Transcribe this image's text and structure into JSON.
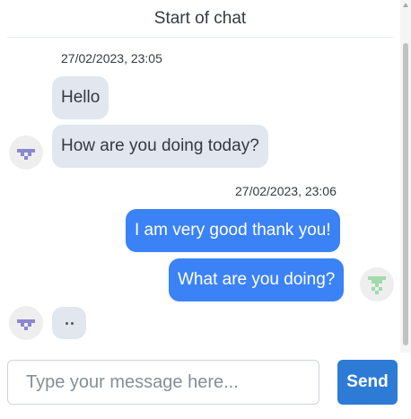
{
  "header": {
    "title": "Start of chat"
  },
  "messages": {
    "group1": {
      "timestamp": "27/02/2023, 23:05",
      "bubbles": [
        "Hello",
        "How are you doing today?"
      ]
    },
    "group2": {
      "timestamp": "27/02/2023, 23:06",
      "bubbles": [
        "I am very good thank you!",
        "What are you doing?"
      ]
    }
  },
  "typing": {
    "indicator": "typing-dots"
  },
  "composer": {
    "placeholder": "Type your message here...",
    "value": "",
    "send_label": "Send"
  },
  "colors": {
    "incoming_bubble": "#e2e6ee",
    "outgoing_bubble": "#3b82f6",
    "send_button": "#2e7bd6",
    "avatar_other": "#8b87cf",
    "avatar_self": "#9fd9ac"
  }
}
